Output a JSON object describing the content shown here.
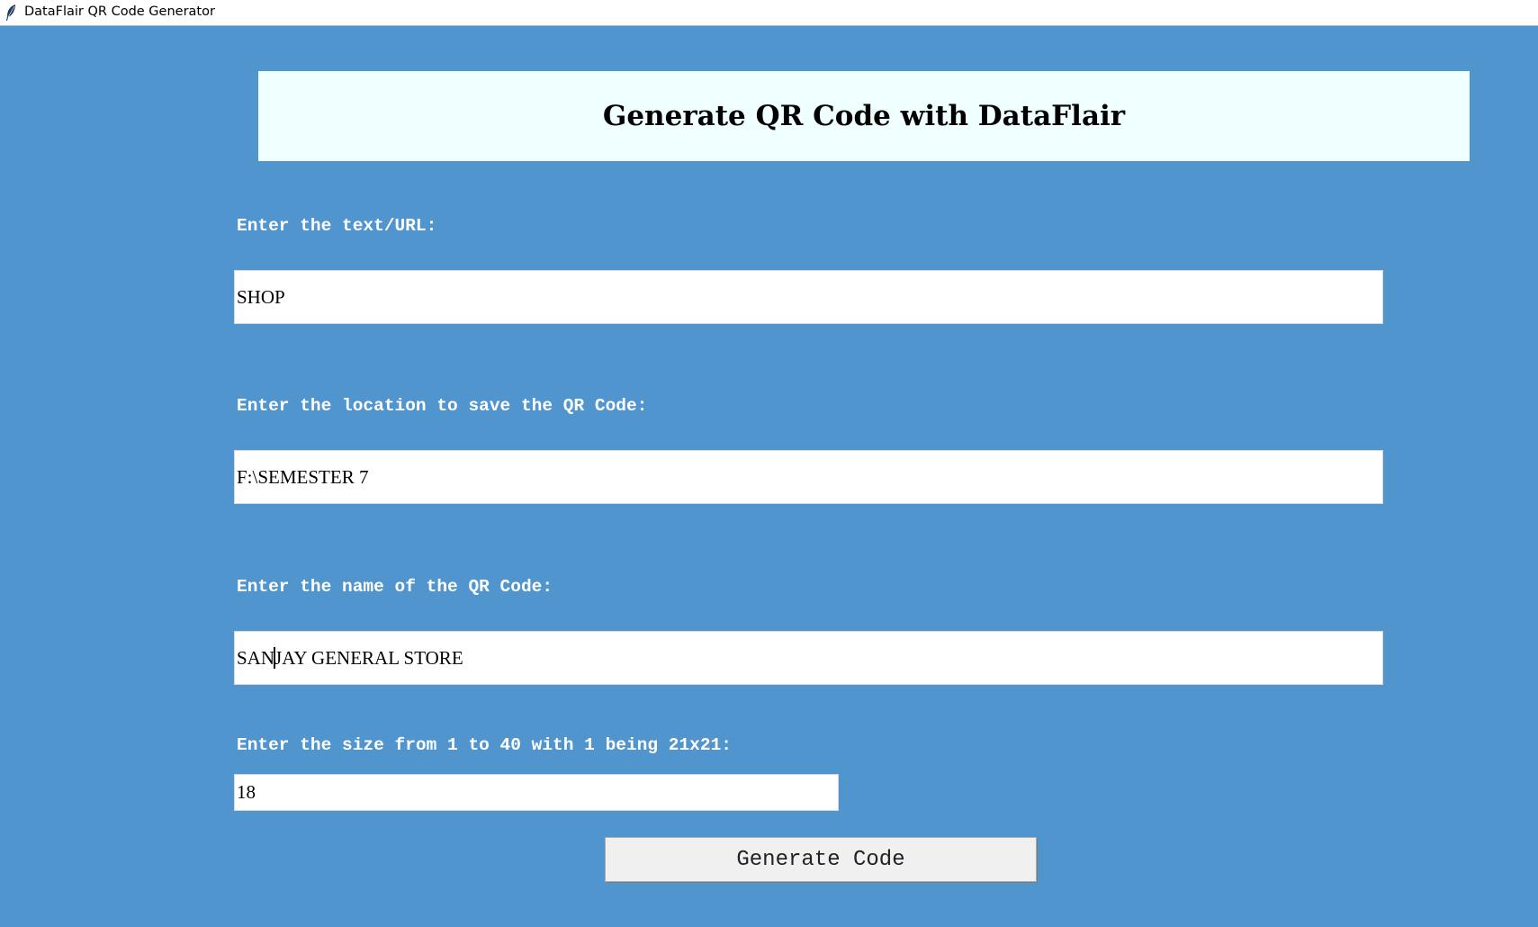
{
  "window": {
    "title": "DataFlair QR Code Generator",
    "icon": "feather-icon"
  },
  "header": {
    "heading": "Generate QR Code with DataFlair"
  },
  "form": {
    "text_label": "Enter the text/URL:",
    "text_value": "SHOP",
    "location_label": "Enter the location to save the QR Code:",
    "location_value": "F:\\SEMESTER 7",
    "name_label": "Enter the name of the QR Code:",
    "name_value_before_caret": "SAN",
    "name_value_after_caret": "JAY GENERAL STORE",
    "size_label": "Enter the size from 1 to 40 with 1 being 21x21:",
    "size_value": "18",
    "generate_button": "Generate Code"
  },
  "colors": {
    "background": "#5195cf",
    "banner": "#f0ffff",
    "label_text": "#ffffff",
    "button": "#f0f0f0"
  }
}
